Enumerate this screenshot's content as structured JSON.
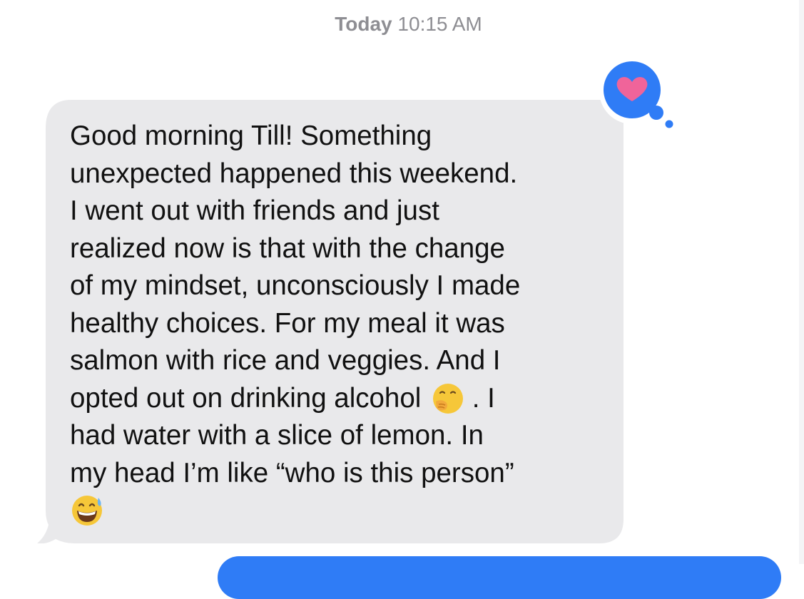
{
  "timestamp": {
    "day": "Today",
    "time": "10:15 AM"
  },
  "message": {
    "lines": [
      "Good morning Till! Something",
      "unexpected happened this weekend.",
      "I went out with friends and just",
      "realized now is that with the change",
      "of my mindset, unconsciously I made",
      "healthy choices. For my meal it was",
      "salmon with rice and veggies. And I",
      "opted out on drinking alcohol",
      ".  I",
      "had water with a slice of lemon.  In",
      "my head I’m like “who is this person”"
    ],
    "emojis": [
      "face-with-hand-over-mouth",
      "grinning-face-with-sweat"
    ]
  },
  "tapback": {
    "reaction": "heart-icon",
    "color": "#2f7cf6",
    "heart_color": "#f0649a"
  },
  "colors": {
    "incoming_bubble": "#e9e9eb",
    "outgoing_bubble": "#2f7cf6",
    "timestamp": "#8e8e93"
  }
}
